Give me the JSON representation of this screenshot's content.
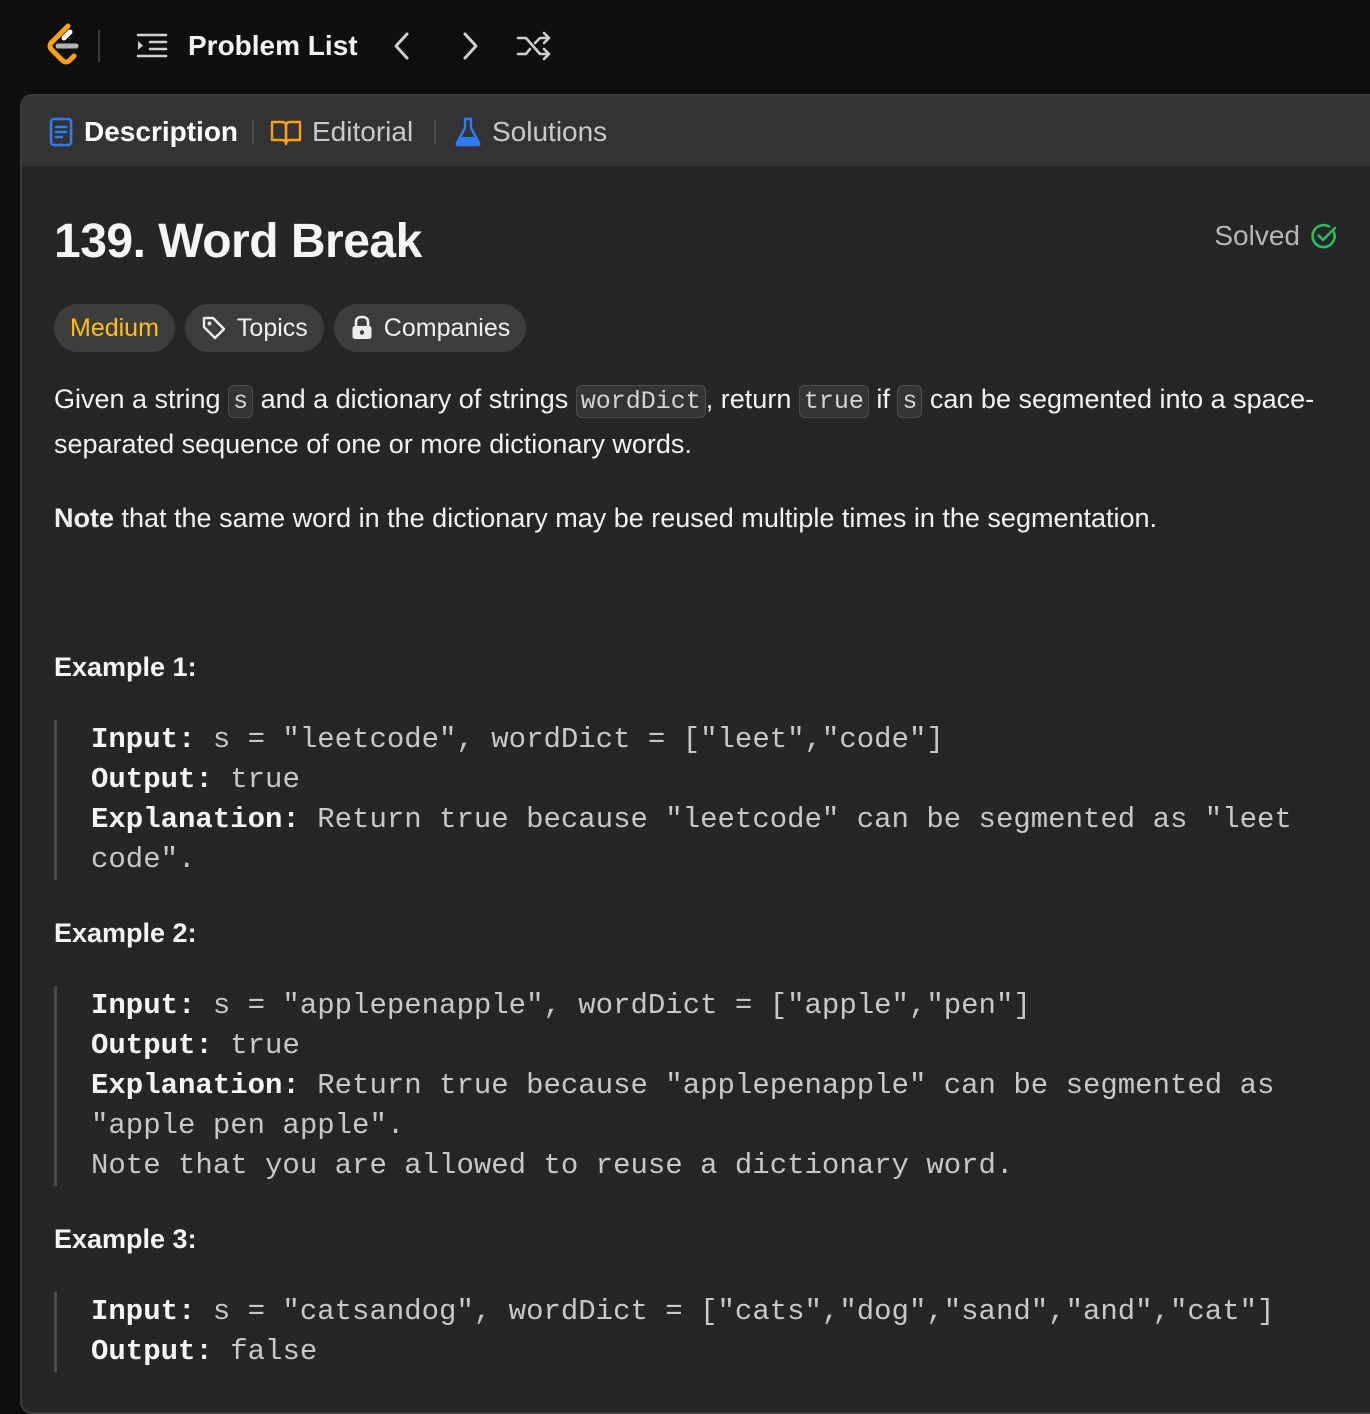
{
  "topbar": {
    "problem_list_label": "Problem List"
  },
  "tabs": [
    {
      "label": "Description",
      "icon": "description-icon"
    },
    {
      "label": "Editorial",
      "icon": "book-icon"
    },
    {
      "label": "Solutions",
      "icon": "flask-icon"
    }
  ],
  "problem": {
    "title": "139. Word Break",
    "status": "Solved",
    "difficulty": "Medium",
    "topics_label": "Topics",
    "companies_label": "Companies",
    "desc_parts": [
      "Given a string ",
      "s",
      " and a dictionary of strings ",
      "wordDict",
      ", return ",
      "true",
      " if ",
      "s",
      " can be segmented into a space-separated sequence of one or more dictionary words."
    ],
    "note_bold": "Note",
    "note_text": " that the same word in the dictionary may be reused multiple times in the segmentation."
  },
  "examples": [
    {
      "title": "Example 1:",
      "input_label": "Input:",
      "input": " s = \"leetcode\", wordDict = [\"leet\",\"code\"]",
      "output_label": "Output:",
      "output": " true",
      "explanation_label": "Explanation:",
      "explanation": " Return true because \"leetcode\" can be segmented as \"leet code\"."
    },
    {
      "title": "Example 2:",
      "input_label": "Input:",
      "input": " s = \"applepenapple\", wordDict = [\"apple\",\"pen\"]",
      "output_label": "Output:",
      "output": " true",
      "explanation_label": "Explanation:",
      "explanation": " Return true because \"applepenapple\" can be segmented as \"apple pen apple\".",
      "extra": "Note that you are allowed to reuse a dictionary word."
    },
    {
      "title": "Example 3:",
      "input_label": "Input:",
      "input": " s = \"catsandog\", wordDict = [\"cats\",\"dog\",\"sand\",\"and\",\"cat\"]",
      "output_label": "Output:",
      "output": " false"
    }
  ],
  "colors": {
    "background": "#0f0f0f",
    "panel": "#262626",
    "medium": "#ffc01e",
    "solved_check": "#2cbb5d",
    "description_icon": "#2f7cf6",
    "flask_icon": "#2f7cf6",
    "book_icon": "#ffa116",
    "logo_orange": "#ffa116"
  }
}
